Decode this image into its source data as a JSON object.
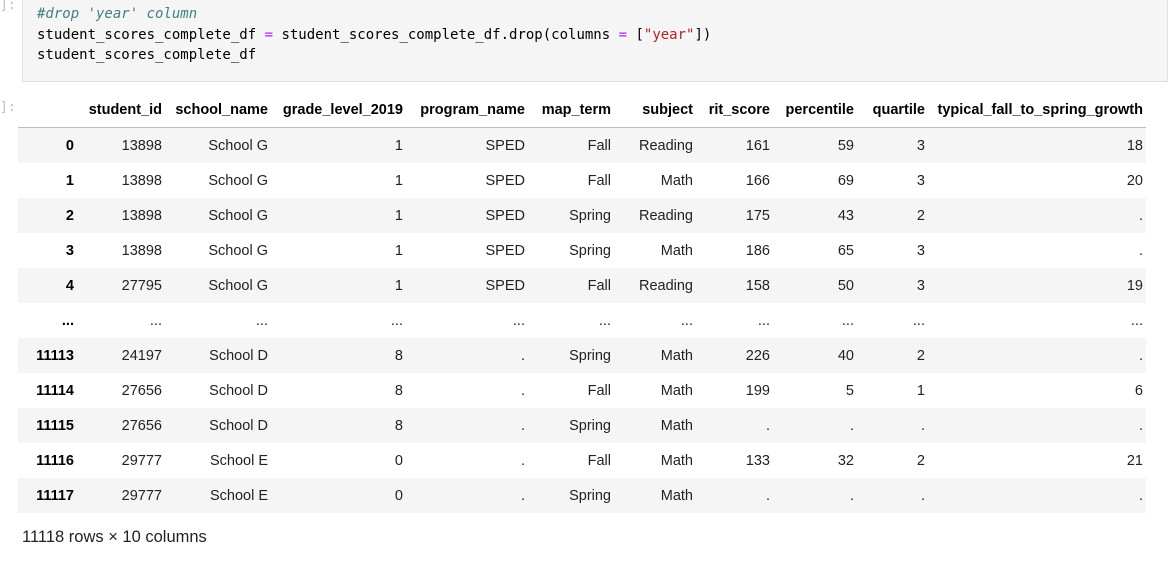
{
  "cells": {
    "input_prompt": "]:",
    "output_prompt": "]:"
  },
  "code": {
    "line1": "#drop 'year' column",
    "line2_var": "student_scores_complete_df ",
    "line2_eq": "=",
    "line2_mid": " student_scores_complete_df.drop(columns ",
    "line2_eq2": "=",
    "line2_open": " [",
    "line2_str": "\"year\"",
    "line2_close": "])",
    "line3": "student_scores_complete_df"
  },
  "dataframe": {
    "columns": [
      "student_id",
      "school_name",
      "grade_level_2019",
      "program_name",
      "map_term",
      "subject",
      "rit_score",
      "percentile",
      "quartile",
      "typical_fall_to_spring_growth"
    ],
    "rows": [
      {
        "index": "0",
        "cells": [
          "13898",
          "School G",
          "1",
          "SPED",
          "Fall",
          "Reading",
          "161",
          "59",
          "3",
          "18"
        ]
      },
      {
        "index": "1",
        "cells": [
          "13898",
          "School G",
          "1",
          "SPED",
          "Fall",
          "Math",
          "166",
          "69",
          "3",
          "20"
        ]
      },
      {
        "index": "2",
        "cells": [
          "13898",
          "School G",
          "1",
          "SPED",
          "Spring",
          "Reading",
          "175",
          "43",
          "2",
          "."
        ]
      },
      {
        "index": "3",
        "cells": [
          "13898",
          "School G",
          "1",
          "SPED",
          "Spring",
          "Math",
          "186",
          "65",
          "3",
          "."
        ]
      },
      {
        "index": "4",
        "cells": [
          "27795",
          "School G",
          "1",
          "SPED",
          "Fall",
          "Reading",
          "158",
          "50",
          "3",
          "19"
        ]
      },
      {
        "index": "...",
        "cells": [
          "...",
          "...",
          "...",
          "...",
          "...",
          "...",
          "...",
          "...",
          "...",
          "..."
        ]
      },
      {
        "index": "11113",
        "cells": [
          "24197",
          "School D",
          "8",
          ".",
          "Spring",
          "Math",
          "226",
          "40",
          "2",
          "."
        ]
      },
      {
        "index": "11114",
        "cells": [
          "27656",
          "School D",
          "8",
          ".",
          "Fall",
          "Math",
          "199",
          "5",
          "1",
          "6"
        ]
      },
      {
        "index": "11115",
        "cells": [
          "27656",
          "School D",
          "8",
          ".",
          "Spring",
          "Math",
          ".",
          ".",
          ".",
          "."
        ]
      },
      {
        "index": "11116",
        "cells": [
          "29777",
          "School E",
          "0",
          ".",
          "Fall",
          "Math",
          "133",
          "32",
          "2",
          "21"
        ]
      },
      {
        "index": "11117",
        "cells": [
          "29777",
          "School E",
          "0",
          ".",
          "Spring",
          "Math",
          ".",
          ".",
          ".",
          "."
        ]
      }
    ],
    "shape_text": "11118 rows × 10 columns"
  }
}
